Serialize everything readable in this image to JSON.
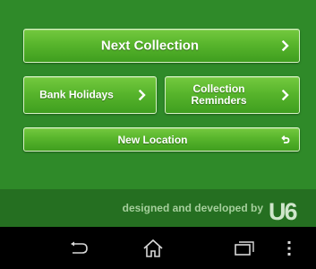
{
  "menu": {
    "next_collection": "Next Collection",
    "bank_holidays": "Bank Holidays",
    "collection_reminders": "Collection Reminders",
    "new_location": "New Location"
  },
  "footer": {
    "credit_text": "designed and developed by",
    "logo_text": "U6"
  },
  "colors": {
    "background": "#2f8a29",
    "footer_background": "#256f21",
    "button_gradient_top": "#74c93f",
    "button_gradient_bottom": "#3f9e1f",
    "button_border": "#d7f2c4"
  },
  "navbar": {
    "icons": [
      "back-icon",
      "home-icon",
      "recent-apps-icon",
      "overflow-menu-icon"
    ]
  }
}
